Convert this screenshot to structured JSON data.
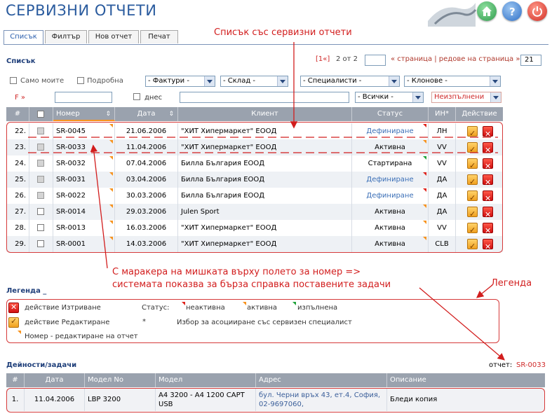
{
  "header": {
    "title": "СЕРВИЗНИ ОТЧЕТИ",
    "buttons": [
      "home",
      "help",
      "power"
    ]
  },
  "tabs": [
    {
      "label": "Списък",
      "active": true
    },
    {
      "label": "Филтър",
      "active": false
    },
    {
      "label": "Нов отчет",
      "active": false
    },
    {
      "label": "Печат",
      "active": false
    }
  ],
  "list": {
    "title": "Списък",
    "pager": {
      "first": "[1«]",
      "page_info": "2 от 2",
      "page_input": "",
      "page_link": "« страница | редове на страница »",
      "rows_per_page": "21"
    },
    "filters": {
      "only_mine": "Само моите",
      "detailed": "Подробна",
      "invoices": "- Фактури -",
      "warehouse": "- Склад -",
      "specialists": "- Специалисти -",
      "branches": "- Клонове -",
      "f_label": "F »",
      "today": "днес",
      "status_all": "- Всички -",
      "unfinished": "Неизпълнени"
    },
    "columns": [
      "#",
      "",
      "Номер",
      "Дата",
      "Клиент",
      "Статус",
      "ИН*",
      "Действие"
    ],
    "rows": [
      {
        "n": "22.",
        "num": "SR-0045",
        "date": "21.06.2006",
        "client": "\"ХИТ Хипермаркет\" ЕООД",
        "status": "Дефиниране",
        "status_type": "def",
        "in": "ЛН"
      },
      {
        "n": "23.",
        "num": "SR-0033",
        "date": "11.04.2006",
        "client": "\"ХИТ Хипермаркет\" ЕООД",
        "status": "Активна",
        "status_type": "act",
        "in": "VV"
      },
      {
        "n": "24.",
        "num": "SR-0032",
        "date": "07.04.2006",
        "client": "Билла България ЕООД",
        "status": "Стартирана",
        "status_type": "start",
        "in": "VV"
      },
      {
        "n": "25.",
        "num": "SR-0031",
        "date": "03.04.2006",
        "client": "Билла България ЕООД",
        "status": "Дефиниране",
        "status_type": "def",
        "in": "ДА"
      },
      {
        "n": "26.",
        "num": "SR-0022",
        "date": "30.03.2006",
        "client": "Билла България ЕООД",
        "status": "Дефиниране",
        "status_type": "def",
        "in": "ДА"
      },
      {
        "n": "27.",
        "num": "SR-0014",
        "date": "29.03.2006",
        "client": "Julen Sport",
        "status": "Активна",
        "status_type": "act",
        "in": "ДА"
      },
      {
        "n": "28.",
        "num": "SR-0013",
        "date": "16.03.2006",
        "client": "\"ХИТ Хипермаркет\" ЕООД",
        "status": "Активна",
        "status_type": "act",
        "in": "VV"
      },
      {
        "n": "29.",
        "num": "SR-0001",
        "date": "14.03.2006",
        "client": "\"ХИТ Хипермаркет\" ЕООД",
        "status": "Активна",
        "status_type": "act",
        "in": "CLB"
      }
    ]
  },
  "legend": {
    "title": "Легенда _",
    "delete": "действие Изтриване",
    "edit": "действие Редактиране",
    "number_note": "Номер - редактиране на отчет",
    "status_label": "Статус:",
    "inactive": "неактивна",
    "active": "активна",
    "done": "изпълнена",
    "star": "*",
    "star_note": "Избор за асоцииране със сервизен специалист"
  },
  "tasks": {
    "title": "Дейности/задачи",
    "report_label": "отчет:",
    "report_id": "SR-0033",
    "columns": [
      "#",
      "Дата",
      "Модел No",
      "Модел",
      "Адрес",
      "Описание"
    ],
    "rows": [
      {
        "n": "1.",
        "date": "11.04.2006",
        "model_no": "LBP 3200",
        "model": "A4 3200 - A4 1200 CAPT USB",
        "address": "бул. Черни връх 43, ет.4, София, 02-9697060,",
        "description": "Бледи копия"
      }
    ]
  },
  "annotations": {
    "list_note": "Списък със сервизни отчети",
    "hover_note_1": "С маракера на мишката върху полето за номер =>",
    "hover_note_2": "системата показва за бърза справка поставените задачи",
    "legend_note": "Легенда"
  },
  "colors": {
    "title": "#2a5b9e",
    "annotation": "#d21d1d",
    "header_row": "#9aa2ae",
    "status_def": "#3b6fb7",
    "marker_orange": "#f7931e",
    "marker_red": "#e0231c",
    "marker_green": "#1fa33a"
  }
}
